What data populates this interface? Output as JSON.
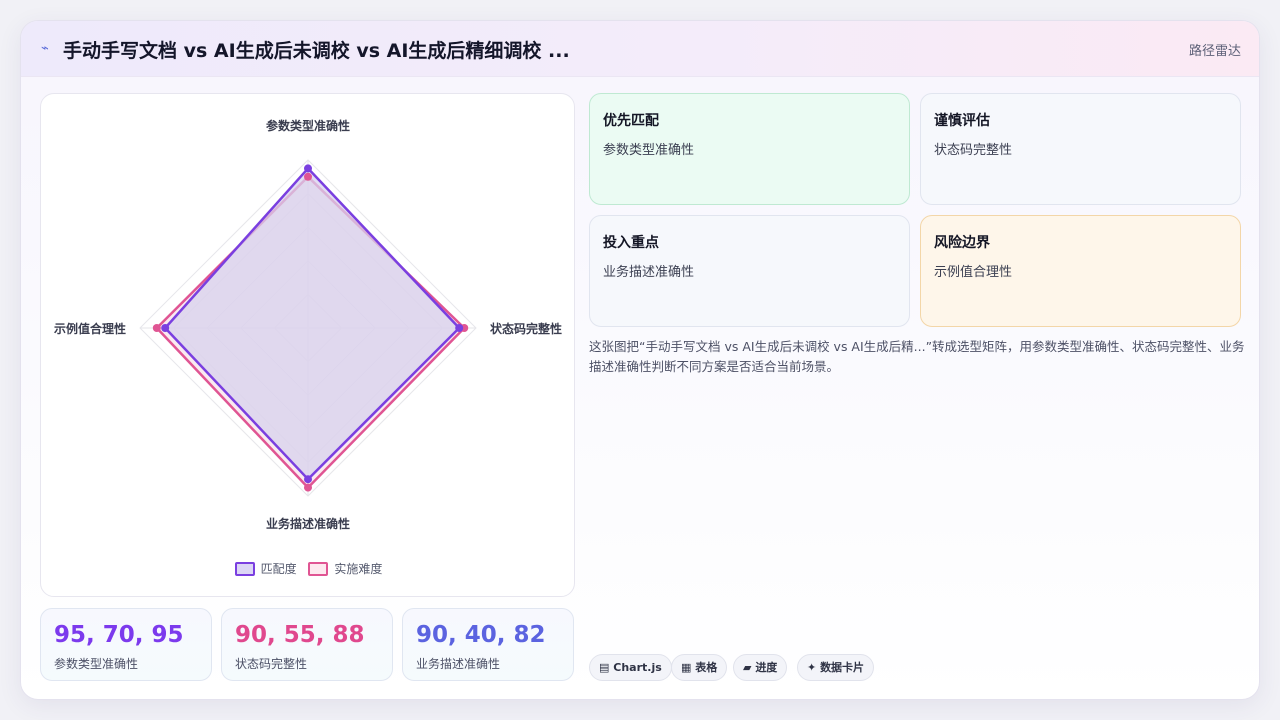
{
  "header": {
    "title": "手动手写文档 vs AI生成后未调校 vs AI生成后精细调校 ...",
    "tag": "路径雷达"
  },
  "chart_data": {
    "type": "radar",
    "axes": [
      "参数类型准确性",
      "状态码完整性",
      "业务描述准确性",
      "示例值合理性"
    ],
    "rlim": [
      0,
      100
    ],
    "series": [
      {
        "name": "匹配度",
        "values": [
          95,
          90,
          90,
          85
        ],
        "color": "#7a3fe0",
        "fill": "#d7d2ee"
      },
      {
        "name": "实施难度",
        "values": [
          90,
          93,
          95,
          90
        ],
        "color": "#e05593",
        "fill": "#f6d9e4"
      }
    ],
    "grid": true,
    "legend_position": "bottom"
  },
  "stats": [
    {
      "value": "95, 70, 95",
      "label": "参数类型准确性",
      "color": "#7c3aed"
    },
    {
      "value": "90, 55, 88",
      "label": "状态码完整性",
      "color": "#e0488e"
    },
    {
      "value": "90, 40, 82",
      "label": "业务描述准确性",
      "color": "#5b63e0"
    }
  ],
  "tiles": [
    {
      "title": "优先匹配",
      "sub": "参数类型准确性",
      "style": "green"
    },
    {
      "title": "谨慎评估",
      "sub": "状态码完整性",
      "style": "plain"
    },
    {
      "title": "投入重点",
      "sub": "业务描述准确性",
      "style": "plain"
    },
    {
      "title": "风险边界",
      "sub": "示例值合理性",
      "style": "orange"
    }
  ],
  "description": "这张图把“手动手写文档 vs AI生成后未调校 vs AI生成后精...”转成选型矩阵，用参数类型准确性、状态码完整性、业务描述准确性判断不同方案是否适合当前场景。",
  "footer_tags": [
    {
      "icon": "chart-icon",
      "glyph": "▤",
      "label": "Chart.js"
    },
    {
      "icon": "table-icon",
      "glyph": "▦",
      "label": "表格"
    },
    {
      "icon": "progress-icon",
      "glyph": "▰",
      "label": "进度"
    },
    {
      "icon": "data-card-icon",
      "glyph": "✦",
      "label": "数据卡片"
    }
  ]
}
